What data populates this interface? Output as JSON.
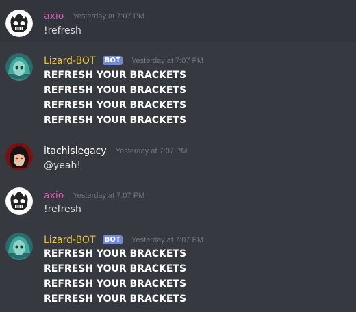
{
  "users": {
    "axio": {
      "name": "axio",
      "color": "#e056b8"
    },
    "lizard": {
      "name": "Lizard-BOT",
      "color": "#e8c23e",
      "badge": "BOT"
    },
    "itachi": {
      "name": "itachislegacy",
      "color": "#ffffff"
    }
  },
  "messages": [
    {
      "author": "axio",
      "timestamp": "Yesterday at 7:07 PM",
      "lines": [
        "!refresh"
      ]
    },
    {
      "author": "Lizard-BOT",
      "badge": "BOT",
      "timestamp": "Yesterday at 7:07 PM",
      "lines": [
        "REFRESH YOUR BRACKETS",
        "REFRESH YOUR BRACKETS",
        "REFRESH YOUR BRACKETS",
        "REFRESH YOUR BRACKETS"
      ]
    },
    {
      "author": "itachislegacy",
      "timestamp": "Yesterday at 7:07 PM",
      "lines": [
        "@yeah!"
      ]
    },
    {
      "author": "axio",
      "timestamp": "Yesterday at 7:07 PM",
      "lines": [
        "!refresh"
      ]
    },
    {
      "author": "Lizard-BOT",
      "badge": "BOT",
      "timestamp": "Yesterday at 7:07 PM",
      "lines": [
        "REFRESH YOUR BRACKETS",
        "REFRESH YOUR BRACKETS",
        "REFRESH YOUR BRACKETS",
        "REFRESH YOUR BRACKETS"
      ]
    }
  ]
}
